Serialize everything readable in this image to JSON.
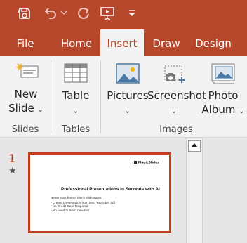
{
  "tabs": [
    {
      "label": "File"
    },
    {
      "label": "Home"
    },
    {
      "label": "Insert",
      "active": true
    },
    {
      "label": "Draw"
    },
    {
      "label": "Design"
    }
  ],
  "ribbon": {
    "new_slide": {
      "line1": "New",
      "line2": "Slide"
    },
    "table": {
      "label": "Table"
    },
    "pictures": {
      "label": "Pictures"
    },
    "screenshot": {
      "label": "Screenshot"
    },
    "photo_album": {
      "line1": "Photo",
      "line2": "Album"
    },
    "groups": {
      "slides": "Slides",
      "tables": "Tables",
      "images": "Images"
    }
  },
  "slide_pane": {
    "slide_number": "1",
    "slide": {
      "brand": "MagicSlides",
      "title": "Professional Presentations in Seconds with AI",
      "subtitle": "Never start from a blank slide again.",
      "bullets": [
        "Create presentation from text, YouTube, pdf",
        "No Credit Card Required",
        "No need to learn new tool"
      ]
    }
  },
  "colors": {
    "accent": "#b7472a",
    "ribbon_bg": "#f3f3f3",
    "selection_border": "#c43e1c"
  }
}
